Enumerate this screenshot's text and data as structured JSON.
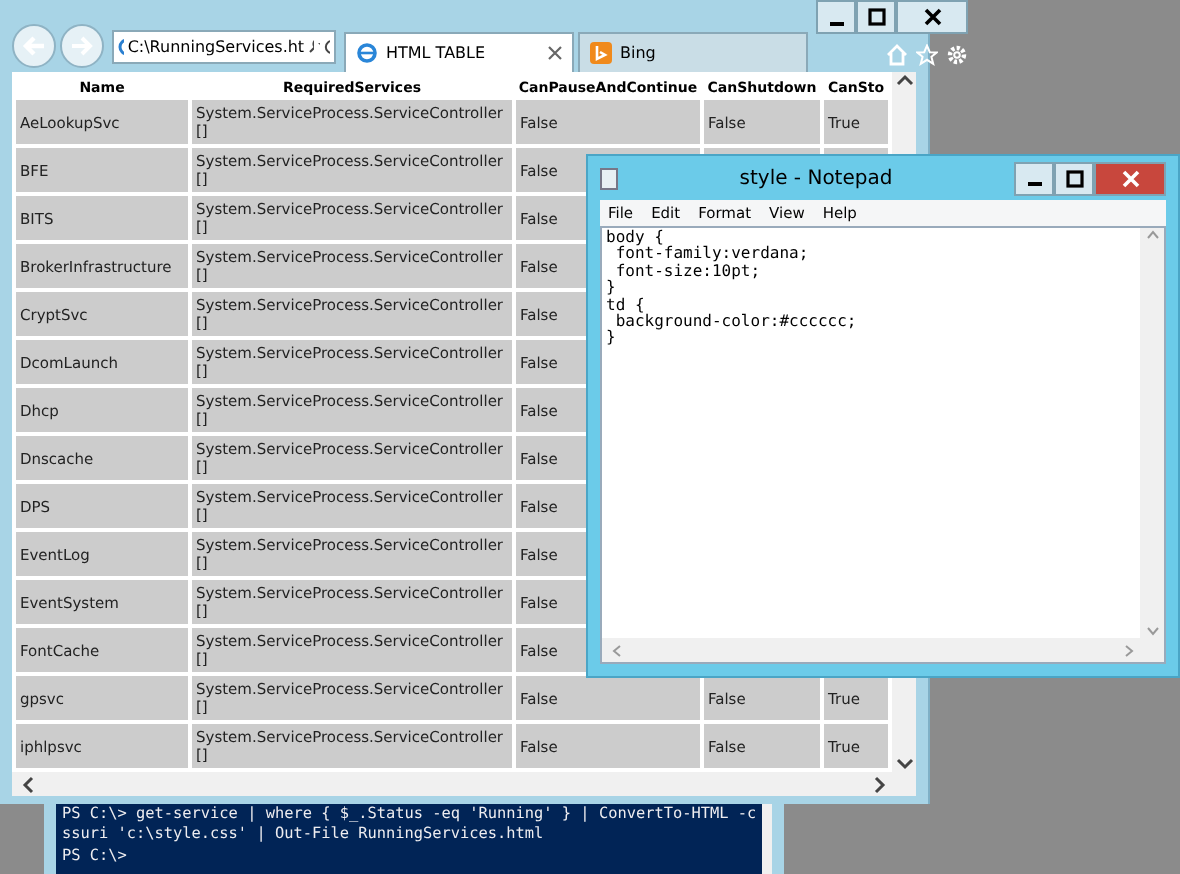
{
  "browser": {
    "address": "C:\\RunningServices.ht",
    "tabs": [
      {
        "label": "HTML TABLE",
        "selected": true
      },
      {
        "label": "Bing",
        "selected": false
      }
    ],
    "table": {
      "columns": [
        "Name",
        "RequiredServices",
        "CanPauseAndContinue",
        "CanShutdown",
        "CanSto"
      ],
      "rows": [
        {
          "cells": [
            "AeLookupSvc",
            "System.ServiceProcess.ServiceController []",
            "False",
            "False",
            "True"
          ]
        },
        {
          "cells": [
            "BFE",
            "System.ServiceProcess.ServiceController []",
            "False"
          ]
        },
        {
          "cells": [
            "BITS",
            "System.ServiceProcess.ServiceController []",
            "False"
          ]
        },
        {
          "cells": [
            "BrokerInfrastructure",
            "System.ServiceProcess.ServiceController []",
            "False"
          ]
        },
        {
          "cells": [
            "CryptSvc",
            "System.ServiceProcess.ServiceController []",
            "False"
          ]
        },
        {
          "cells": [
            "DcomLaunch",
            "System.ServiceProcess.ServiceController []",
            "False"
          ]
        },
        {
          "cells": [
            "Dhcp",
            "System.ServiceProcess.ServiceController []",
            "False"
          ]
        },
        {
          "cells": [
            "Dnscache",
            "System.ServiceProcess.ServiceController []",
            "False"
          ]
        },
        {
          "cells": [
            "DPS",
            "System.ServiceProcess.ServiceController []",
            "False"
          ]
        },
        {
          "cells": [
            "EventLog",
            "System.ServiceProcess.ServiceController []",
            "False"
          ]
        },
        {
          "cells": [
            "EventSystem",
            "System.ServiceProcess.ServiceController []",
            "False"
          ]
        },
        {
          "cells": [
            "FontCache",
            "System.ServiceProcess.ServiceController []",
            "False"
          ]
        },
        {
          "cells": [
            "gpsvc",
            "System.ServiceProcess.ServiceController []",
            "False",
            "False",
            "True"
          ]
        },
        {
          "cells": [
            "iphlpsvc",
            "System.ServiceProcess.ServiceController []",
            "False",
            "False",
            "True"
          ]
        }
      ]
    }
  },
  "notepad": {
    "title": "style - Notepad",
    "menu": [
      "File",
      "Edit",
      "Format",
      "View",
      "Help"
    ],
    "lines": [
      "body {",
      " font-family:verdana;",
      " font-size:10pt;",
      "}",
      "td {",
      " background-color:#cccccc;",
      "}"
    ]
  },
  "console": {
    "lines": [
      "PS C:\\> get-service | where { $_.Status -eq 'Running' } | ConvertTo-HTML -c",
      "ssuri 'c:\\style.css' | Out-File RunningServices.html",
      "PS C:\\>"
    ]
  }
}
